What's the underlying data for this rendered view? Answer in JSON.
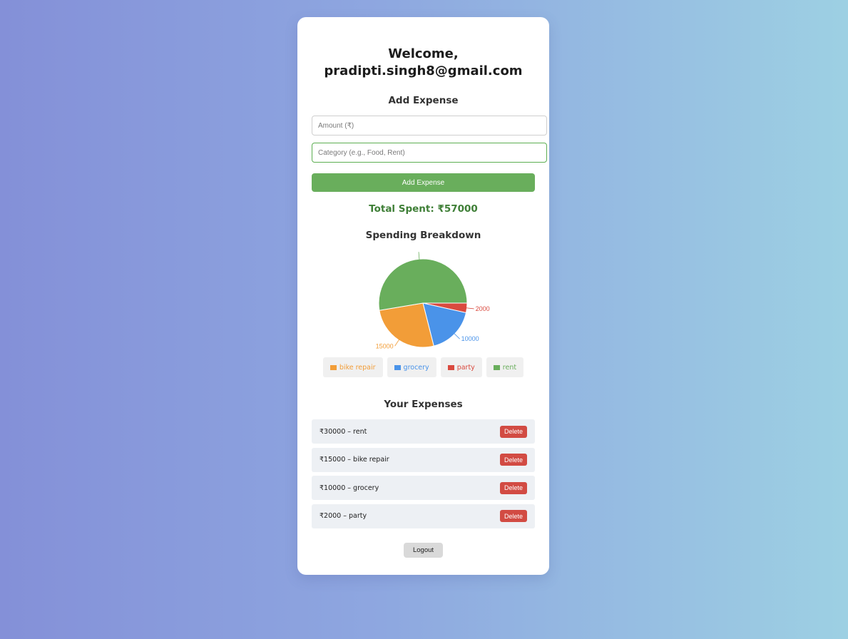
{
  "welcome": {
    "line1": "Welcome,",
    "email": "pradipti.singh8@gmail.com"
  },
  "form": {
    "title": "Add Expense",
    "amount_placeholder": "Amount (₹)",
    "category_placeholder": "Category (e.g., Food, Rent)",
    "submit_label": "Add Expense"
  },
  "total": {
    "label": "Total Spent: ₹57000"
  },
  "chart": {
    "title": "Spending Breakdown"
  },
  "chart_data": {
    "type": "pie",
    "title": "Spending Breakdown",
    "categories": [
      "bike repair",
      "grocery",
      "party",
      "rent"
    ],
    "values": [
      15000,
      10000,
      2000,
      30000
    ],
    "colors": [
      "#f29d38",
      "#4a93e9",
      "#da4a3f",
      "#69ae5c"
    ],
    "data_labels": [
      "15000",
      "10000",
      "2000",
      ""
    ],
    "legend_position": "bottom"
  },
  "legend": [
    {
      "label": "bike repair",
      "color": "#f29d38"
    },
    {
      "label": "grocery",
      "color": "#4a93e9"
    },
    {
      "label": "party",
      "color": "#da4a3f"
    },
    {
      "label": "rent",
      "color": "#69ae5c"
    }
  ],
  "expenses": {
    "title": "Your Expenses",
    "delete_label": "Delete",
    "items": [
      {
        "text": "₹30000 – rent"
      },
      {
        "text": "₹15000 – bike repair"
      },
      {
        "text": "₹10000 – grocery"
      },
      {
        "text": "₹2000 – party"
      }
    ]
  },
  "logout_label": "Logout"
}
